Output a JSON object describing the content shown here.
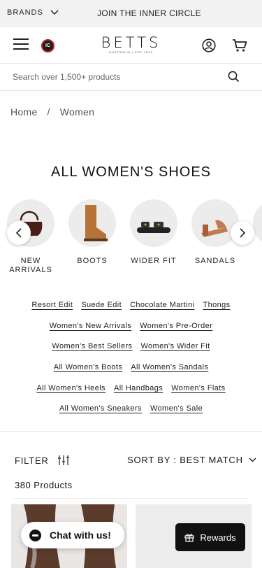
{
  "promo": {
    "brands_label": "BRANDS",
    "circle_label": "JOIN THE INNER CIRCLE"
  },
  "header": {
    "ic_badge": "IC",
    "logo_wordmark": "BETTS",
    "logo_tagline": "AUSTRALIA | EST 1899",
    "icons": [
      "menu-icon",
      "account-icon",
      "cart-icon"
    ]
  },
  "search": {
    "placeholder": "Search over 1,500+ products"
  },
  "breadcrumb": {
    "home": "Home",
    "separator": "/",
    "current": "Women"
  },
  "page_title": "ALL WOMEN'S SHOES",
  "categories": [
    {
      "label": "NEW ARRIVALS"
    },
    {
      "label": "BOOTS"
    },
    {
      "label": "WIDER FIT"
    },
    {
      "label": "SANDALS"
    },
    {
      "label": "B"
    }
  ],
  "quick_links": [
    [
      "Resort Edit",
      "Suede Edit",
      "Chocolate Martini",
      "Thongs"
    ],
    [
      "Women's New Arrivals",
      "Women's Pre-Order"
    ],
    [
      "Women's Best Sellers",
      "Women's Wider Fit"
    ],
    [
      "All Women's Boots",
      "All Women's Sandals"
    ],
    [
      "All Women's Heels",
      "All Handbags",
      "Women's Flats"
    ],
    [
      "All Women's Sneakers",
      "Women's Sale"
    ]
  ],
  "toolbar": {
    "filter_label": "FILTER",
    "sort_label": "SORT BY : BEST MATCH"
  },
  "product_count": "380 Products",
  "chat": {
    "label": "Chat with us!"
  },
  "rewards": {
    "label": "Rewards"
  },
  "colors": {
    "badge_ring": "#b3262c",
    "rewards_bg": "#111111"
  }
}
